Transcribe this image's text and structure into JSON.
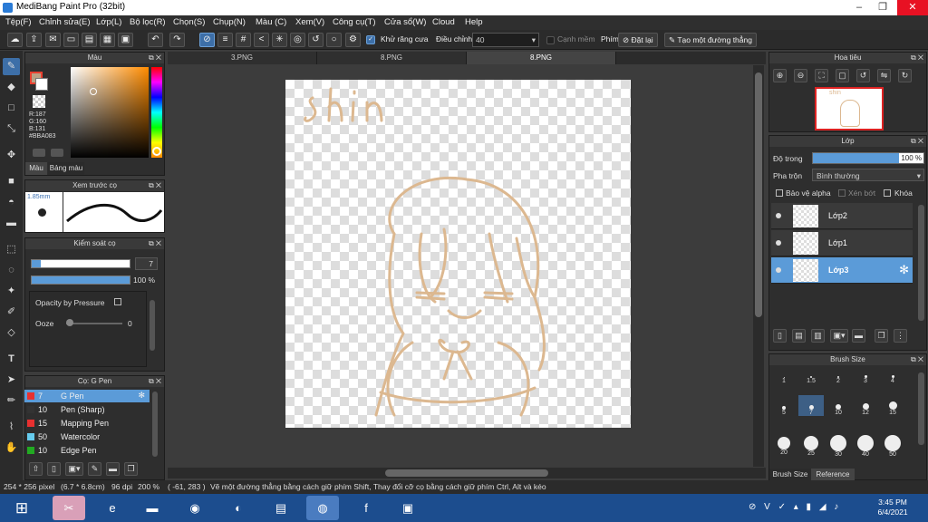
{
  "window": {
    "title": "MediBang Paint Pro (32bit)"
  },
  "menu": [
    "Tệp(F)",
    "Chỉnh sửa(E)",
    "Lớp(L)",
    "Bộ lọc(R)",
    "Chọn(S)",
    "Chụp(N)",
    "Màu (C)",
    "Xem(V)",
    "Công cụ(T)",
    "Cửa sổ(W)",
    "Cloud",
    "Help"
  ],
  "toolbar": {
    "antialias_label": "Khử răng cưa",
    "adjust_label": "Điều chỉnh",
    "adjust_value": "40",
    "edge_label": "Cạnh mềm",
    "prim_label": "Phím",
    "reset_label": "Đặt lại",
    "straight_line_label": "Tạo một đường thẳng"
  },
  "tabs": [
    "3.PNG",
    "8.PNG",
    "8.PNG"
  ],
  "color_panel": {
    "title": "Màu",
    "r": "R:187",
    "g": "G:160",
    "b": "B:131",
    "hex": "#BBA083",
    "tab_color": "Màu",
    "tab_palette": "Bảng màu",
    "main_color": "#bba083"
  },
  "brush_preview": {
    "title": "Xem trước cọ",
    "size": "1.85mm"
  },
  "brush_control": {
    "title": "Kiểm soát cọ",
    "size_value": "7",
    "size_fraction": 0.09,
    "opacity_value": "100 %",
    "opacity_fraction": 1.0,
    "opacity_pressure_label": "Opacity by Pressure",
    "ooze_label": "Ooze",
    "ooze_value": "0"
  },
  "brush_list": {
    "title": "Cọ: G Pen",
    "items": [
      {
        "size": "7",
        "name": "G Pen",
        "color": "#e83030"
      },
      {
        "size": "10",
        "name": "Pen (Sharp)",
        "color": "#333333"
      },
      {
        "size": "15",
        "name": "Mapping Pen",
        "color": "#e83030"
      },
      {
        "size": "50",
        "name": "Watercolor",
        "color": "#66ccee"
      },
      {
        "size": "10",
        "name": "Edge Pen",
        "color": "#22aa22"
      }
    ]
  },
  "navigator": {
    "title": "Hoa tiêu"
  },
  "layers": {
    "title": "Lớp",
    "opacity_label": "Độ trong",
    "opacity_value": "100 %",
    "opacity_fraction": 1.0,
    "blend_label": "Pha trộn",
    "blend_value": "Bình thường",
    "protect_alpha": "Bảo vệ alpha",
    "clipping": "Xén bớt",
    "lock": "Khóa",
    "items": [
      {
        "name": "Lớp2"
      },
      {
        "name": "Lớp1"
      },
      {
        "name": "Lớp3"
      }
    ]
  },
  "brush_size": {
    "title": "Brush Size",
    "row1": [
      "1",
      "1.5",
      "2",
      "3",
      "4"
    ],
    "row2": [
      "5",
      "7",
      "10",
      "12",
      "15"
    ],
    "row3": [
      "20",
      "25",
      "30",
      "40",
      "50"
    ],
    "tab_size": "Brush Size",
    "tab_reference": "Reference"
  },
  "status": {
    "dims": "254 * 256 pixel",
    "cm": "(6.7 * 6.8cm)",
    "dpi": "96 dpi",
    "zoom": "200 %",
    "coords": "( -61, 283 )",
    "hint": "Vẽ một đường thẳng bằng cách giữ phím Shift, Thay đổi cỡ cọ bằng cách giữ phím Ctrl, Alt và kéo"
  },
  "canvas_text": "shin",
  "clock": {
    "time": "3:45 PM",
    "date": "6/4/2021"
  }
}
